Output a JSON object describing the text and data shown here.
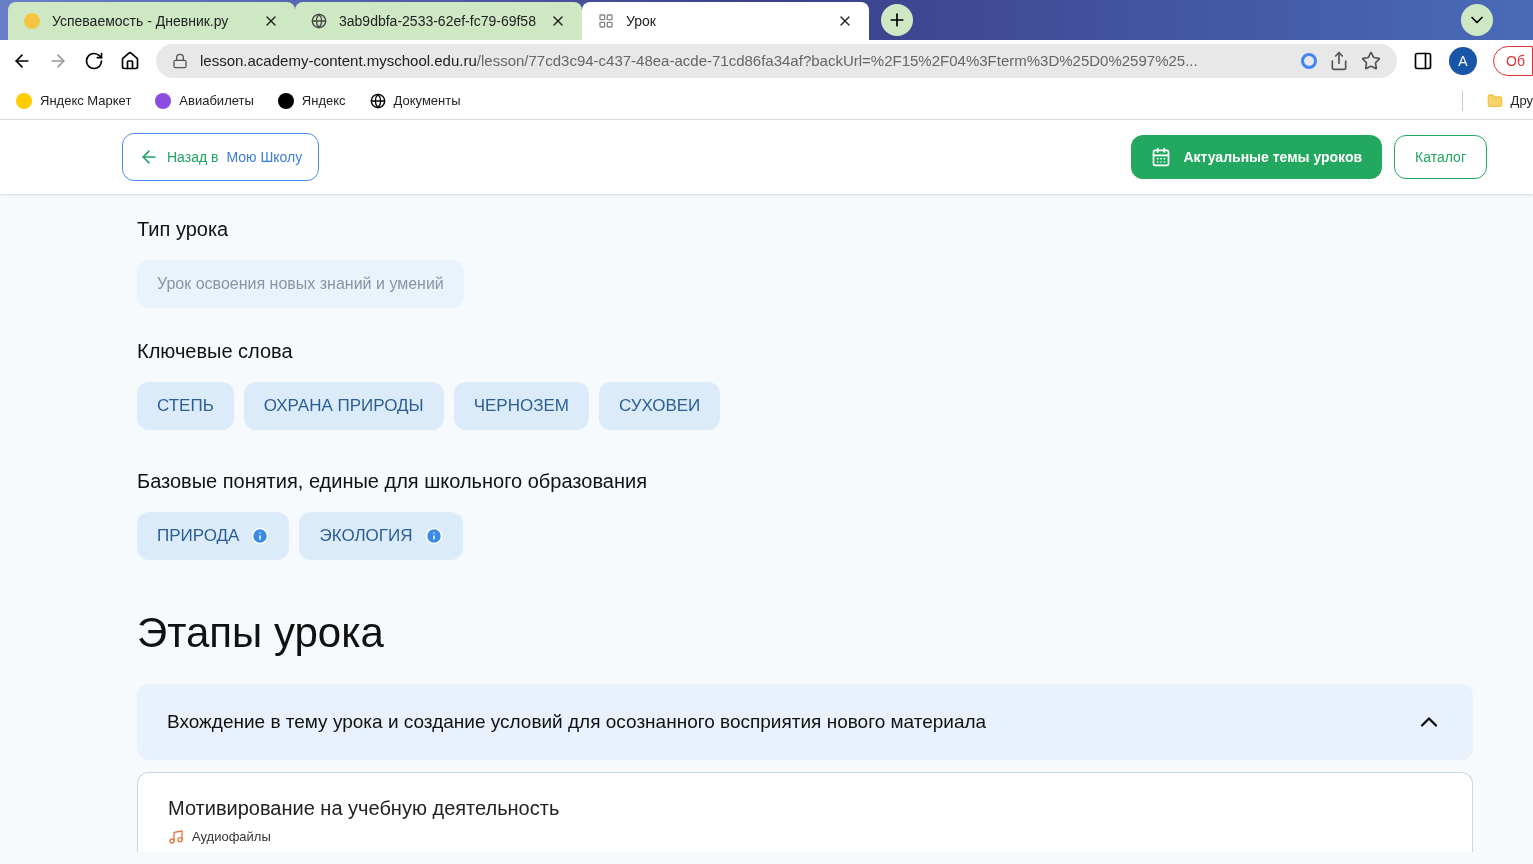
{
  "browser": {
    "tabs": [
      {
        "title": "Успеваемость - Дневник.ру",
        "selected": false
      },
      {
        "title": "3ab9dbfa-2533-62ef-fc79-69f58",
        "selected": false
      },
      {
        "title": "Урок",
        "selected": true
      }
    ],
    "url": {
      "host": "lesson.academy-content.myschool.edu.ru",
      "path": "/lesson/77cd3c94-c437-48ea-acde-71cd86fa34af?backUrl=%2F15%2F04%3Fterm%3D%25D0%2597%25..."
    },
    "profile_initial": "A",
    "profile_button": "Об",
    "bookmarks": [
      {
        "title": "Яндекс Маркет"
      },
      {
        "title": "Авиабилеты"
      },
      {
        "title": "Яндекс"
      },
      {
        "title": "Документы"
      }
    ],
    "other_bookmarks": "Дру"
  },
  "header": {
    "back_button": {
      "prefix": "Назад в",
      "target": "Мою Школу"
    },
    "topics_button": "Актуальные темы уроков",
    "catalog_button": "Каталог"
  },
  "lesson_type": {
    "heading": "Тип урока",
    "value": "Урок освоения новых знаний и умений"
  },
  "keywords": {
    "heading": "Ключевые слова",
    "items": [
      "СТЕПЬ",
      "ОХРАНА ПРИРОДЫ",
      "ЧЕРНОЗЕМ",
      "СУХОВЕИ"
    ]
  },
  "concepts": {
    "heading": "Базовые понятия, единые для школьного образования",
    "items": [
      "ПРИРОДА",
      "ЭКОЛОГИЯ"
    ]
  },
  "stages": {
    "heading": "Этапы урока",
    "items": [
      {
        "title": "Вхождение в тему урока и создание условий для осознанного восприятия нового материала",
        "expanded": true,
        "steps": [
          {
            "title": "Мотивирование на учебную деятельность",
            "attachment": "Аудиофайлы"
          }
        ]
      }
    ]
  }
}
